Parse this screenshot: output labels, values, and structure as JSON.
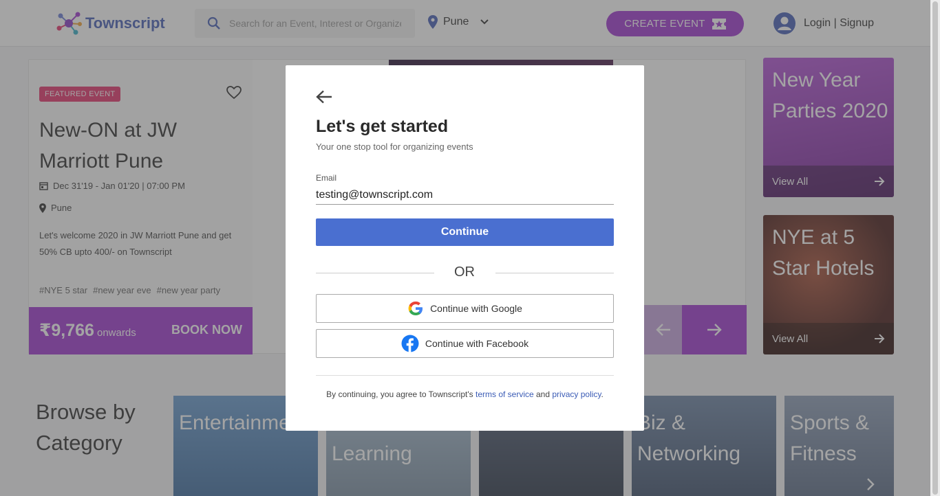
{
  "header": {
    "logo_text": "Townscript",
    "search_placeholder": "Search for an Event, Interest or Organizer",
    "city": "Pune",
    "create_event": "CREATE EVENT",
    "login": "Login | Signup"
  },
  "featured": {
    "badge": "FEATURED EVENT",
    "title": "New-ON at JW Marriott Pune",
    "date": "Dec 31'19 - Jan 01'20 | 07:00 PM",
    "location": "Pune",
    "description": "Let's welcome 2020 in JW Marriott Pune and get 50% CB upto 400/- on Townscript",
    "tags": [
      "#NYE 5 star",
      "#new year eve",
      "#new year party"
    ],
    "price": "₹9,766",
    "onwards": "onwards",
    "book_now": "BOOK NOW"
  },
  "side_tiles": [
    {
      "title": "New Year Parties 2020",
      "link": "View All"
    },
    {
      "title": "NYE at 5 Star Hotels",
      "link": "View All"
    }
  ],
  "browse": {
    "heading": "Browse by Category",
    "categories": [
      "Entertainment",
      "Learning",
      "",
      "Biz & Networking",
      "Sports & Fitness"
    ]
  },
  "modal": {
    "title": "Let's get started",
    "subtitle": "Your one stop tool for organizing events",
    "email_label": "Email",
    "email_value": "testing@townscript.com",
    "continue": "Continue",
    "or": "OR",
    "google": "Continue with Google",
    "facebook": "Continue with Facebook",
    "terms_prefix": "By continuing, you agree to Townscript's ",
    "terms_link": "terms of service",
    "terms_and": " and ",
    "privacy_link": "privacy policy",
    "terms_suffix": "."
  },
  "colors": {
    "brand_purple": "#a13ad1",
    "primary_blue": "#4a6fd0",
    "badge_pink": "#e5376e"
  }
}
